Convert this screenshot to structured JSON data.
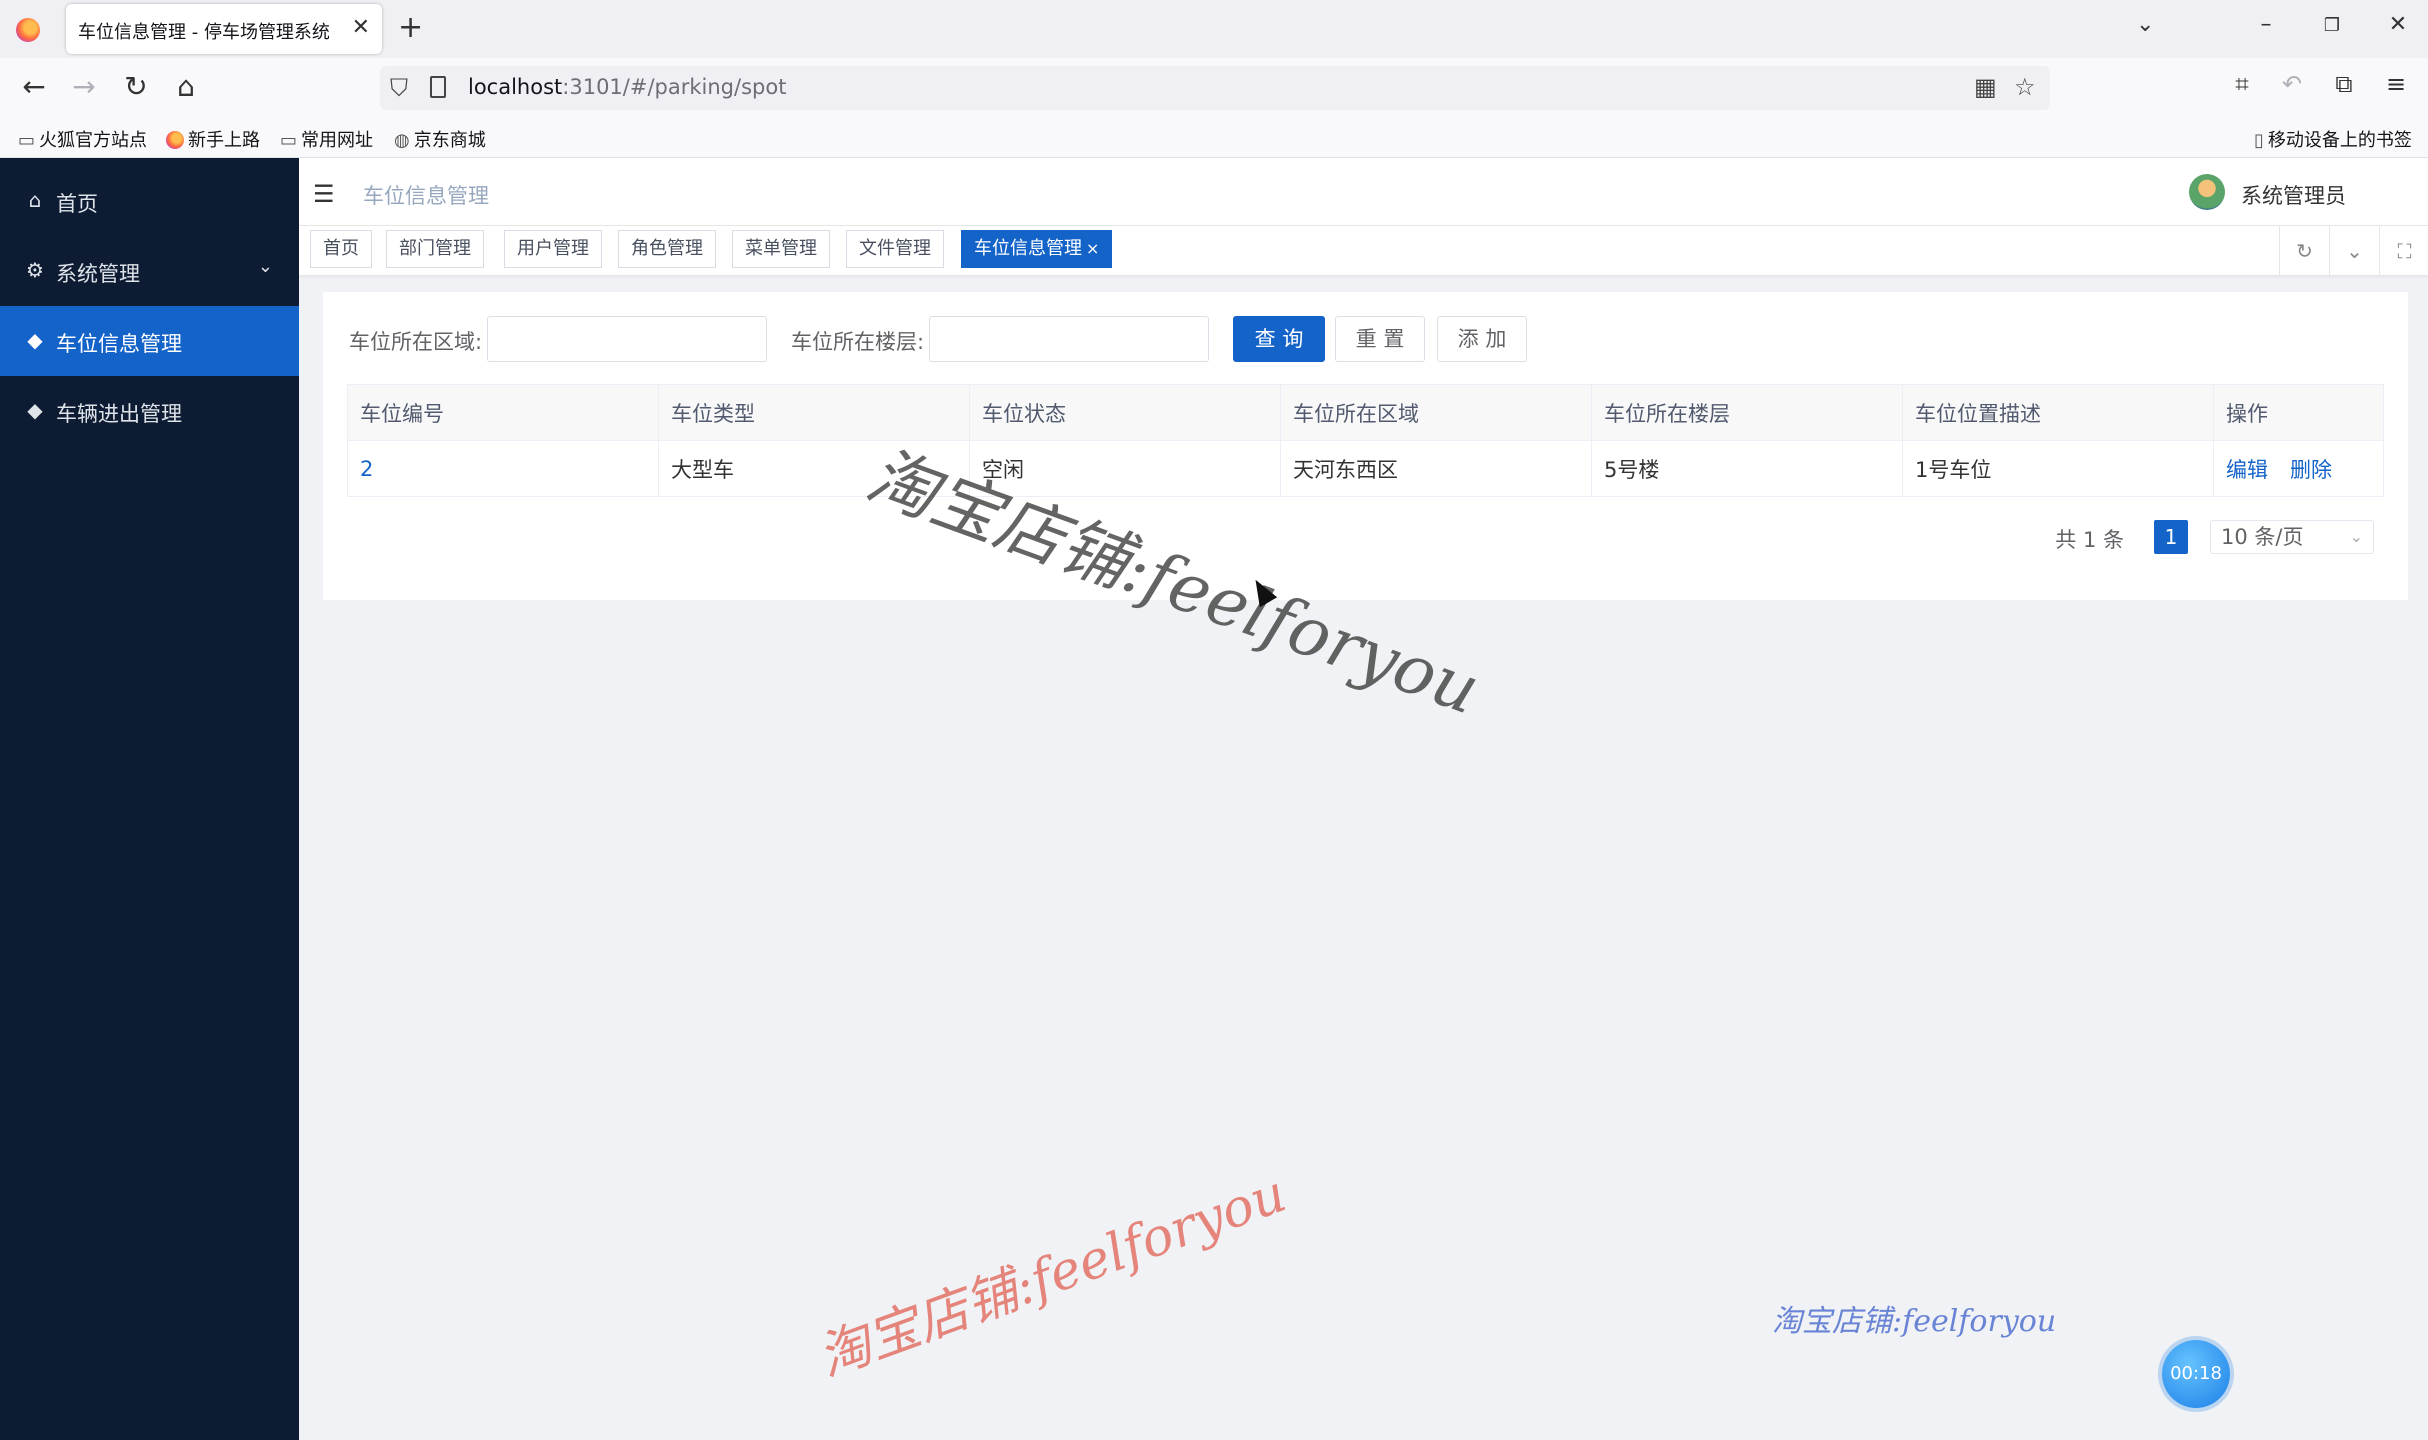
{
  "browser": {
    "tab_title": "车位信息管理 - 停车场管理系统",
    "tab_close": "✕",
    "new_tab": "+",
    "url_host": "localhost",
    "url_path": ":3101/#/parking/spot",
    "bookmarks": [
      {
        "label": "火狐官方站点",
        "icon": "folder-icon"
      },
      {
        "label": "新手上路",
        "icon": "firefox-icon"
      },
      {
        "label": "常用网址",
        "icon": "folder-icon"
      },
      {
        "label": "京东商城",
        "icon": "globe-icon"
      }
    ],
    "mobile_bookmarks": "移动设备上的书签"
  },
  "sidebar": {
    "items": [
      {
        "label": "首页",
        "icon": "home-icon"
      },
      {
        "label": "系统管理",
        "icon": "gear-icon",
        "arrow": "chevron-down-icon"
      },
      {
        "label": "车位信息管理",
        "icon": "tag-icon",
        "active": true
      },
      {
        "label": "车辆进出管理",
        "icon": "tag-icon"
      }
    ]
  },
  "header": {
    "breadcrumb": "车位信息管理",
    "username": "系统管理员"
  },
  "tags": [
    {
      "label": "首页"
    },
    {
      "label": "部门管理"
    },
    {
      "label": "用户管理"
    },
    {
      "label": "角色管理"
    },
    {
      "label": "菜单管理"
    },
    {
      "label": "文件管理"
    },
    {
      "label": "车位信息管理",
      "active": true,
      "close": "×"
    }
  ],
  "search": {
    "area_label": "车位所在区域:",
    "area_value": "",
    "floor_label": "车位所在楼层:",
    "floor_value": "",
    "query_button": "查 询",
    "reset_button": "重 置",
    "add_button": "添 加"
  },
  "table": {
    "columns": [
      "车位编号",
      "车位类型",
      "车位状态",
      "车位所在区域",
      "车位所在楼层",
      "车位位置描述",
      "操作"
    ],
    "rows": [
      {
        "id": "2",
        "type": "大型车",
        "status": "空闲",
        "area": "天河东西区",
        "floor": "5号楼",
        "desc": "1号车位",
        "edit": "编辑",
        "delete": "删除"
      }
    ]
  },
  "pagination": {
    "total": "共 1 条",
    "current_page": "1",
    "page_size": "10 条/页"
  },
  "watermarks": {
    "main": "淘宝店铺:feelforyou",
    "bottom_left": "淘宝店铺:feelforyou",
    "bottom_right": "淘宝店铺:feelforyou"
  },
  "timer": "00:18",
  "colors": {
    "sidebar_bg": "#0d1b33",
    "accent": "#1463c9"
  }
}
